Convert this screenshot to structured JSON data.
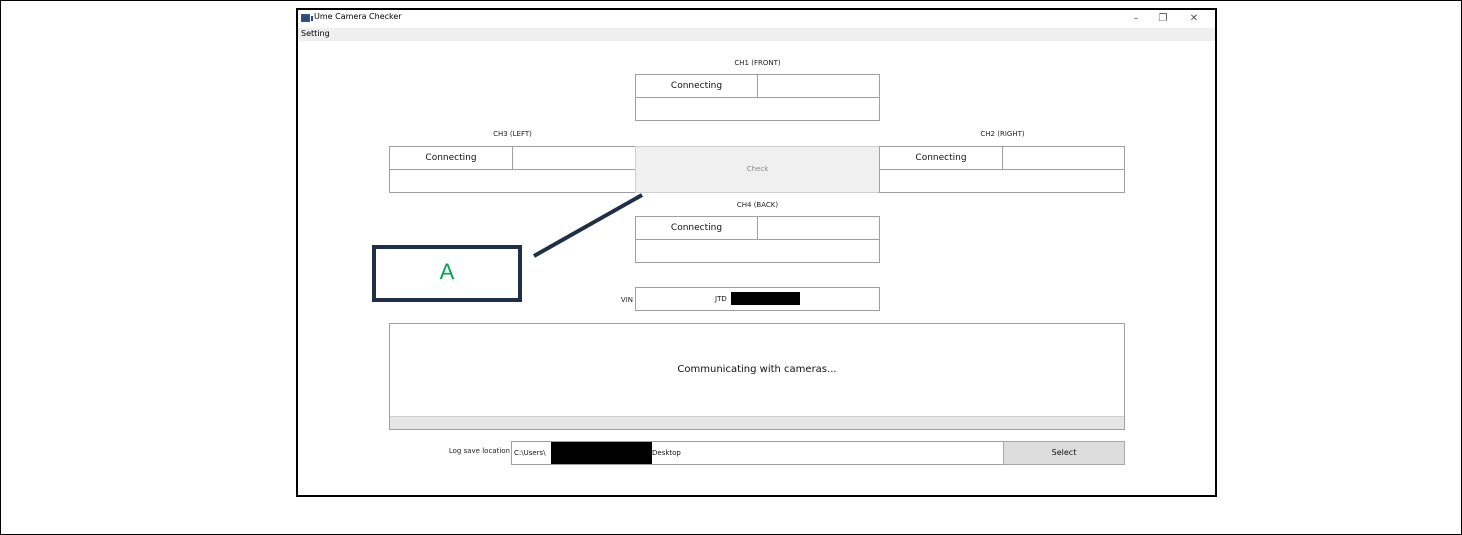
{
  "window": {
    "title": "Ume Camera Checker",
    "controls": {
      "minimize": "–",
      "restore": "❐",
      "close": "✕"
    }
  },
  "menu": {
    "setting": "Setting"
  },
  "channels": {
    "ch1": {
      "label": "CH1 (FRONT)",
      "status": "Connecting",
      "value": "",
      "detail": ""
    },
    "ch2": {
      "label": "CH2 (RIGHT)",
      "status": "Connecting",
      "value": "",
      "detail": ""
    },
    "ch3": {
      "label": "CH3 (LEFT)",
      "status": "Connecting",
      "value": "",
      "detail": ""
    },
    "ch4": {
      "label": "CH4 (BACK)",
      "status": "Connecting",
      "value": "",
      "detail": ""
    }
  },
  "check_button": "Check",
  "vin": {
    "label": "VIN",
    "value": "JTD"
  },
  "status": {
    "message": "Communicating with cameras...",
    "progress": 0
  },
  "log": {
    "label": "Log save location",
    "path_prefix": "C:\\Users\\",
    "path_suffix": "Desktop",
    "select_button": "Select"
  },
  "annotation": {
    "callout_letter": "A",
    "color": "#00a651"
  },
  "colors": {
    "accent_dark": "#1f2f45",
    "progress": "#06b025"
  }
}
